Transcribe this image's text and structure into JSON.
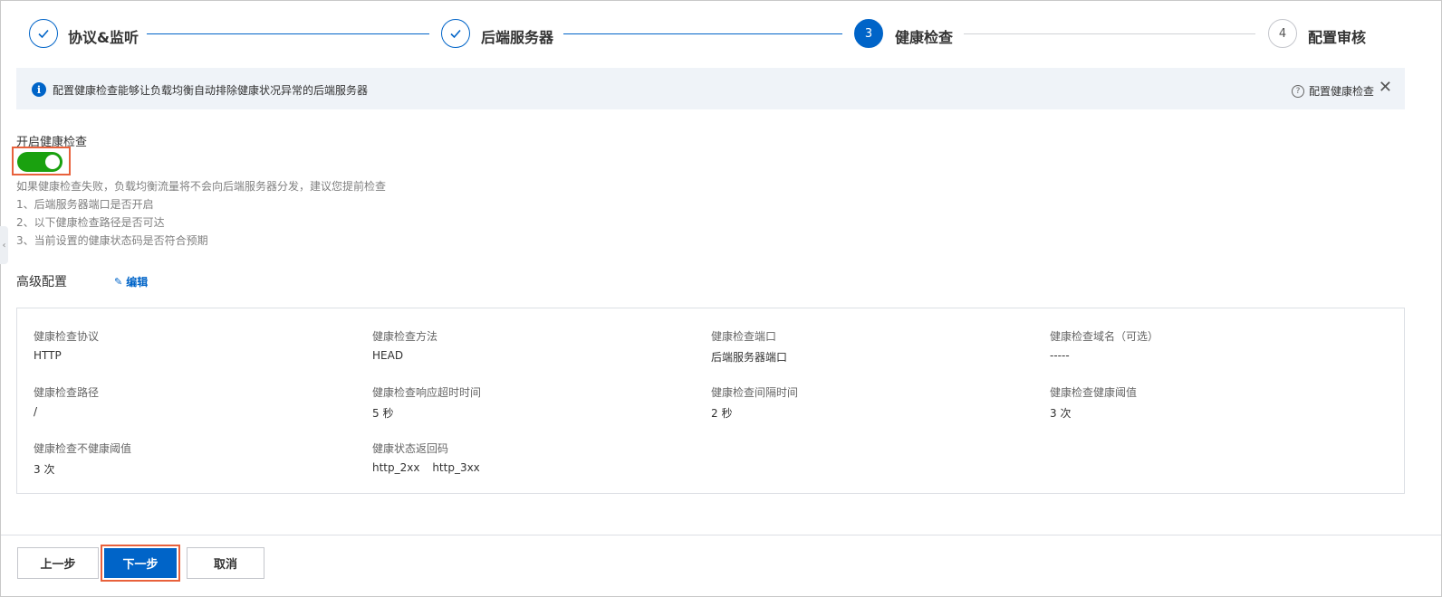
{
  "stepper": {
    "steps": [
      {
        "number": "1",
        "label": "协议&监听",
        "state": "done"
      },
      {
        "number": "2",
        "label": "后端服务器",
        "state": "done"
      },
      {
        "number": "3",
        "label": "健康检查",
        "state": "active"
      },
      {
        "number": "4",
        "label": "配置审核",
        "state": "todo"
      }
    ]
  },
  "banner": {
    "message": "配置健康检查能够让负载均衡自动排除健康状况异常的后端服务器",
    "help_link": "配置健康检查"
  },
  "health_check": {
    "title": "开启健康检查",
    "enabled": true,
    "hints": [
      "如果健康检查失败，负载均衡流量将不会向后端服务器分发，建议您提前检查",
      "1、后端服务器端口是否开启",
      "2、以下健康检查路径是否可达",
      "3、当前设置的健康状态码是否符合预期"
    ]
  },
  "advanced": {
    "title": "高级配置",
    "edit_label": "编辑",
    "fields": {
      "protocol": {
        "label": "健康检查协议",
        "value": "HTTP"
      },
      "method": {
        "label": "健康检查方法",
        "value": "HEAD"
      },
      "port": {
        "label": "健康检查端口",
        "value": "后端服务器端口"
      },
      "domain": {
        "label": "健康检查域名（可选）",
        "value": "-----"
      },
      "path": {
        "label": "健康检查路径",
        "value": "/"
      },
      "timeout": {
        "label": "健康检查响应超时时间",
        "value": "5 秒"
      },
      "interval": {
        "label": "健康检查间隔时间",
        "value": "2 秒"
      },
      "healthy_threshold": {
        "label": "健康检查健康阈值",
        "value": "3 次"
      },
      "unhealthy_threshold": {
        "label": "健康检查不健康阈值",
        "value": "3 次"
      },
      "status_codes": {
        "label": "健康状态返回码",
        "values": [
          "http_2xx",
          "http_3xx"
        ]
      }
    }
  },
  "footer": {
    "prev_label": "上一步",
    "next_label": "下一步",
    "cancel_label": "取消"
  },
  "colors": {
    "primary": "#0064c8",
    "toggle_on": "#1aa10f",
    "highlight": "#e8613c",
    "banner_bg": "#eff3f8"
  },
  "icons": {
    "done_step": "check-icon",
    "banner": "info-icon",
    "help": "question-icon",
    "close": "close-icon",
    "edit": "pencil-icon",
    "collapse": "chevron-left-icon"
  }
}
